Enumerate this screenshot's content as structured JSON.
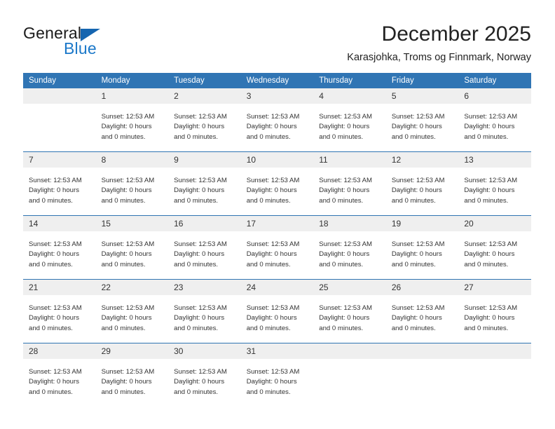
{
  "logo": {
    "word_top": "General",
    "word_bottom": "Blue",
    "triangle_color": "#1565b0",
    "blue_text_color": "#1b78c9"
  },
  "header": {
    "title": "December 2025",
    "subtitle": "Karasjohka, Troms og Finnmark, Norway"
  },
  "colors": {
    "header_blue": "#3075b4",
    "daynum_band": "#efefef",
    "row_divider": "#2f74b2",
    "text": "#333333"
  },
  "weekday_headers": [
    "Sunday",
    "Monday",
    "Tuesday",
    "Wednesday",
    "Thursday",
    "Friday",
    "Saturday"
  ],
  "cell_lines": {
    "sunset": "Sunset: 12:53 AM",
    "daylight": "Daylight: 0 hours",
    "daylight_cont": "and 0 minutes."
  },
  "weeks": [
    [
      {
        "day": "",
        "empty": true
      },
      {
        "day": "1",
        "empty": false
      },
      {
        "day": "2",
        "empty": false
      },
      {
        "day": "3",
        "empty": false
      },
      {
        "day": "4",
        "empty": false
      },
      {
        "day": "5",
        "empty": false
      },
      {
        "day": "6",
        "empty": false
      }
    ],
    [
      {
        "day": "7",
        "empty": false
      },
      {
        "day": "8",
        "empty": false
      },
      {
        "day": "9",
        "empty": false
      },
      {
        "day": "10",
        "empty": false
      },
      {
        "day": "11",
        "empty": false
      },
      {
        "day": "12",
        "empty": false
      },
      {
        "day": "13",
        "empty": false
      }
    ],
    [
      {
        "day": "14",
        "empty": false
      },
      {
        "day": "15",
        "empty": false
      },
      {
        "day": "16",
        "empty": false
      },
      {
        "day": "17",
        "empty": false
      },
      {
        "day": "18",
        "empty": false
      },
      {
        "day": "19",
        "empty": false
      },
      {
        "day": "20",
        "empty": false
      }
    ],
    [
      {
        "day": "21",
        "empty": false
      },
      {
        "day": "22",
        "empty": false
      },
      {
        "day": "23",
        "empty": false
      },
      {
        "day": "24",
        "empty": false
      },
      {
        "day": "25",
        "empty": false
      },
      {
        "day": "26",
        "empty": false
      },
      {
        "day": "27",
        "empty": false
      }
    ],
    [
      {
        "day": "28",
        "empty": false
      },
      {
        "day": "29",
        "empty": false
      },
      {
        "day": "30",
        "empty": false
      },
      {
        "day": "31",
        "empty": false
      },
      {
        "day": "",
        "empty": true
      },
      {
        "day": "",
        "empty": true
      },
      {
        "day": "",
        "empty": true
      }
    ]
  ]
}
